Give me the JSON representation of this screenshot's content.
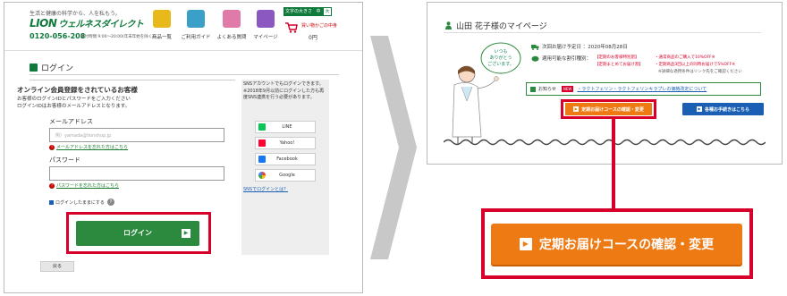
{
  "left": {
    "header": {
      "tagline": "生活と健康の科学から、人を私もう。",
      "logo_lion": "LION",
      "logo_brand": "ウェルネスダイレクト",
      "phone": "0120-056-208",
      "phone_hours": "受付時間 9:00〜20:00(年末年始を除く)",
      "nav": [
        "商品一覧",
        "ご利用ガイド",
        "よくある質問",
        "マイページ"
      ],
      "font_size_label": "文字の大きさ",
      "font_sizes": [
        "中",
        "大"
      ],
      "cart_label": "買い物かごの中身",
      "cart_amount": "0円"
    },
    "page_title": "ログイン",
    "form": {
      "title": "オンライン会員登録をされているお客様",
      "desc": "お客様のログインIDとパスワードをご入力ください\nログインIDはお客様のメールアドレスとなります。",
      "email_label": "メールアドレス",
      "email_placeholder": "例）yamada@lionshop.jp",
      "email_forgot": "メールアドレスを忘れた方はこちら",
      "password_label": "パスワード",
      "password_forgot": "パスワードを忘れた方はこちら",
      "remember": "ログインしたままにする",
      "login_button": "ログイン",
      "back_button": "戻る"
    },
    "sns": {
      "text": "SNSアカウントでもログインできます。\n※2018年9月以前にログインした方も再度SNS連携を行う必要があります。",
      "buttons": [
        "LINE",
        "Yahoo!",
        "Facebook",
        "Google"
      ],
      "link": "SNSでログインとは？"
    }
  },
  "right": {
    "title": "山田 花子様のマイページ",
    "bubble": "いつも\nありがとう\nございます。",
    "next_delivery": "次回お届け予定日 ：2020年08月28日",
    "discount_label": "適用可能な割引種別：",
    "discount_tags": [
      "【定期のお客様特別割】",
      "【定期まとめてお届け割】"
    ],
    "discount_notes": [
      "・通常商品のご購入で10%OFF※",
      "・定期商品3回以上の同時お届けで5%OFF※"
    ],
    "discount_detail": "※詳細な適用条件はリンク先をご確認ください",
    "notice_label": "お知らせ",
    "notice_new": "NEW",
    "notice_text": "・ラクトフェリン・ラクトフェリンキラプレの価格改定について",
    "course_button_small": "定期お届けコースの確認・変更",
    "procedure_button": "各種お手続きはこちら"
  },
  "callout": {
    "course_button_big": "定期お届けコースの確認・変更"
  },
  "colors": {
    "brand_green": "#0f7a3c",
    "highlight_red": "#d6002a",
    "orange": "#ee7a14",
    "blue": "#1a5fb4"
  }
}
